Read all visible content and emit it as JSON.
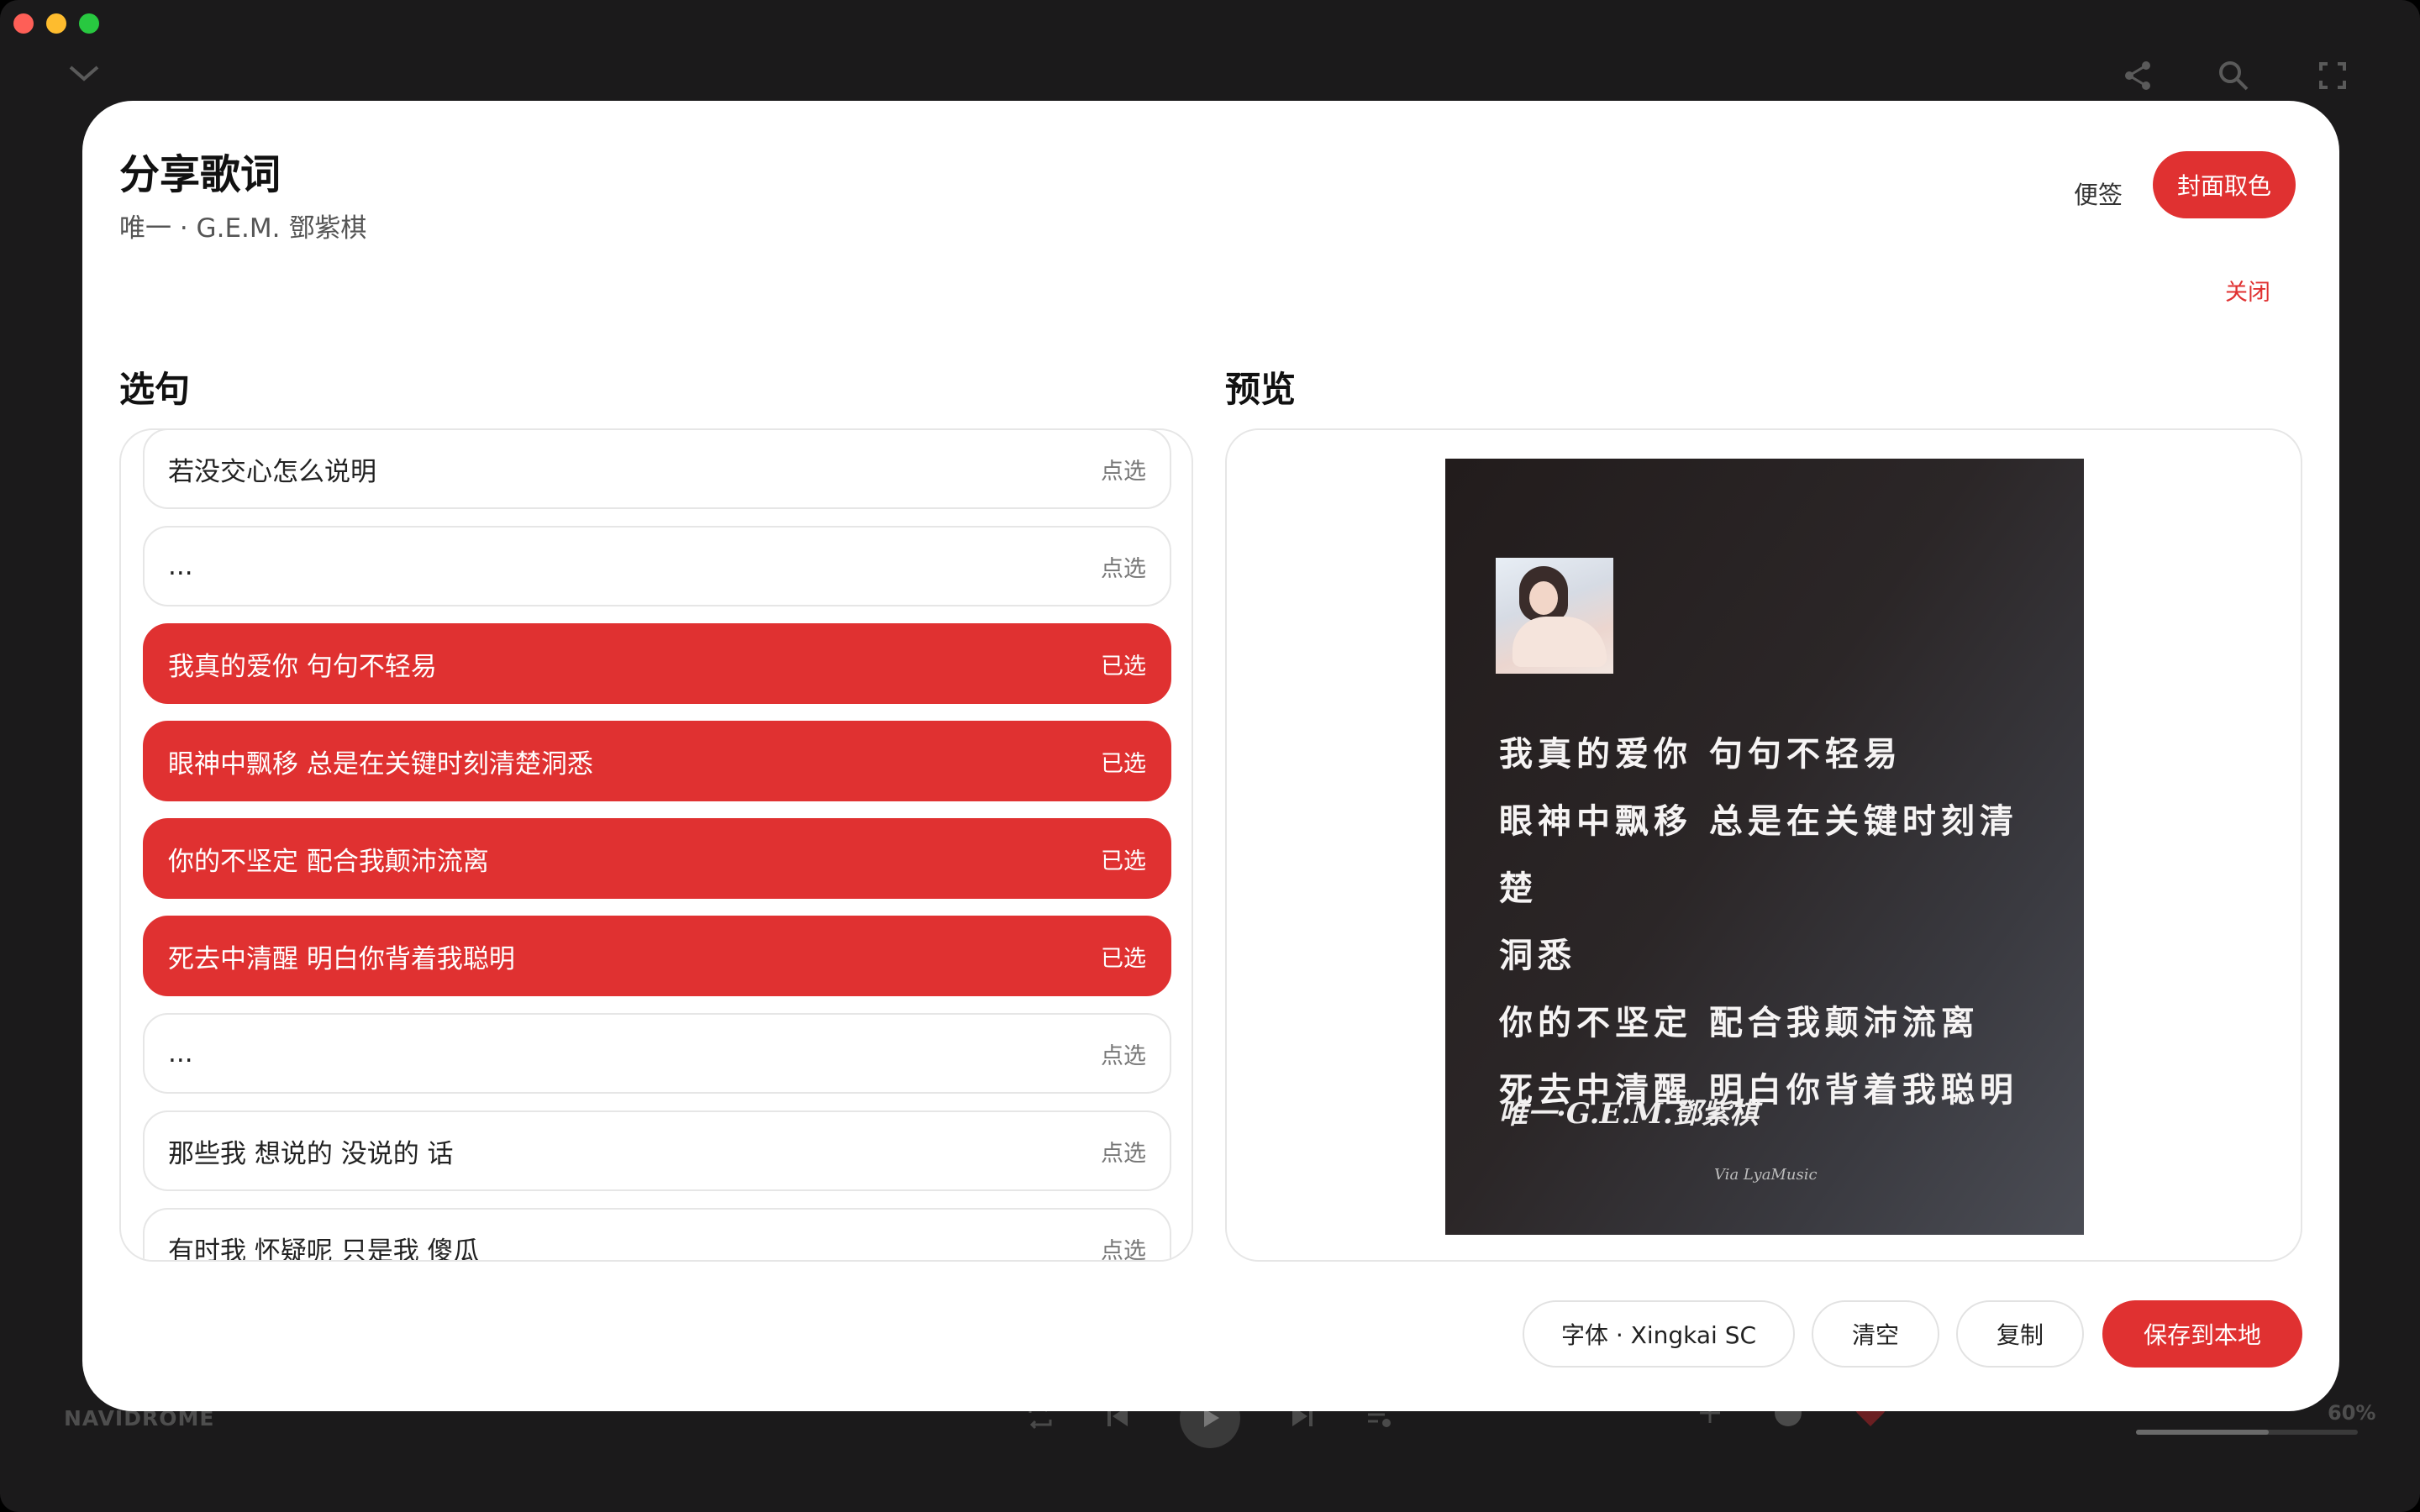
{
  "app": {
    "brand": "NAVIDROME",
    "volume_label": "60%",
    "volume": 0.6
  },
  "modal": {
    "title": "分享歌词",
    "subtitle": "唯一 · G.E.M. 鄧紫棋",
    "memo_button": "便签",
    "cover_color_button": "封面取色",
    "close_button": "关闭",
    "select_title": "选句",
    "preview_title": "预览"
  },
  "lines": [
    {
      "text": "若没交心怎么说明",
      "state": "点选",
      "selected": false
    },
    {
      "text": "...",
      "state": "点选",
      "selected": false
    },
    {
      "text": "我真的爱你 句句不轻易",
      "state": "已选",
      "selected": true
    },
    {
      "text": "眼神中飘移 总是在关键时刻清楚洞悉",
      "state": "已选",
      "selected": true
    },
    {
      "text": "你的不坚定 配合我颠沛流离",
      "state": "已选",
      "selected": true
    },
    {
      "text": "死去中清醒 明白你背着我聪明",
      "state": "已选",
      "selected": true
    },
    {
      "text": "...",
      "state": "点选",
      "selected": false
    },
    {
      "text": "那些我 想说的 没说的 话",
      "state": "点选",
      "selected": false
    },
    {
      "text": "有时我 怀疑呢 只是我 傻瓜",
      "state": "点选",
      "selected": false
    }
  ],
  "preview": {
    "lines": [
      "我真的爱你 句句不轻易",
      "眼神中飘移 总是在关键时刻清楚",
      "洞悉",
      "你的不坚定 配合我颠沛流离",
      "死去中清醒 明白你背着我聪明"
    ],
    "credit": "唯一·G.E.M.鄧紫棋",
    "via": "Via LyaMusic"
  },
  "footer": {
    "font_button": "字体 · Xingkai SC",
    "clear_button": "清空",
    "copy_button": "复制",
    "save_button": "保存到本地"
  },
  "colors": {
    "accent": "#e03131",
    "card_bg": "#2b2627"
  }
}
